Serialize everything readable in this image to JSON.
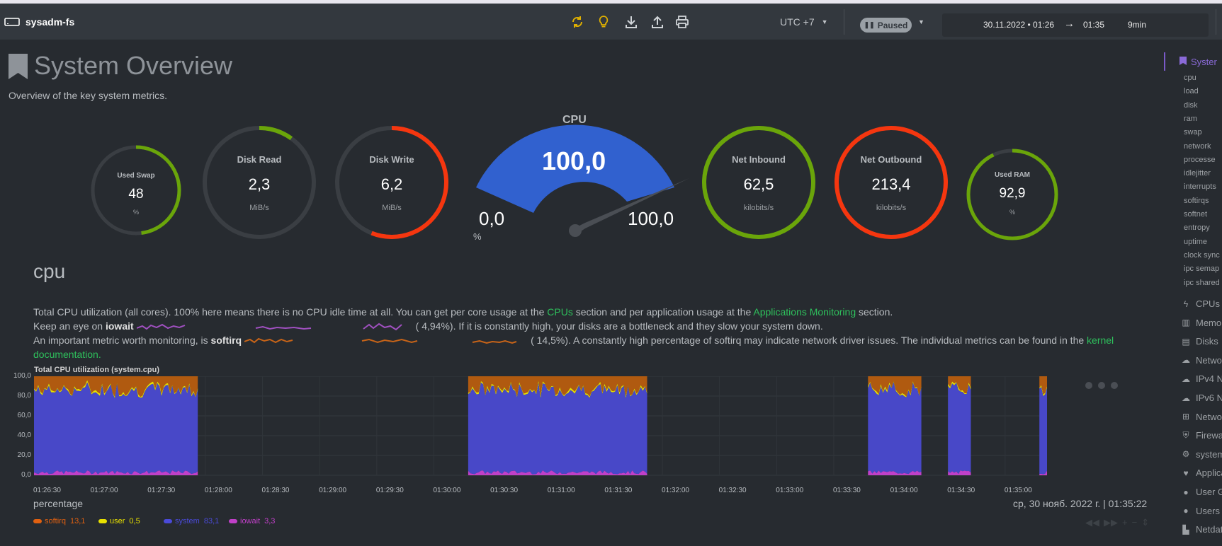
{
  "topbar": {
    "hostname": "sysadm-fs",
    "timezone": "UTC +7",
    "status": "Paused",
    "range_start": "30.11.2022 • 01:26",
    "range_end": "01:35",
    "duration": "9min"
  },
  "page": {
    "title": "System Overview",
    "subtitle": "Overview of the key system metrics."
  },
  "gauges": {
    "used_swap": {
      "title": "Used Swap",
      "value": "48",
      "unit": "%",
      "fill": 0.48,
      "color": "#6aa50a"
    },
    "disk_read": {
      "title": "Disk Read",
      "value": "2,3",
      "unit": "MiB/s",
      "fill": 0.1,
      "color": "#6aa50a"
    },
    "disk_write": {
      "title": "Disk Write",
      "value": "6,2",
      "unit": "MiB/s",
      "fill": 0.56,
      "color": "#f5360f"
    },
    "cpu": {
      "title": "CPU",
      "value": "100,0",
      "min": "0,0",
      "max": "100,0",
      "unit": "%",
      "fill": 1.0,
      "color": "#3161cf"
    },
    "net_inbound": {
      "title": "Net Inbound",
      "value": "62,5",
      "unit": "kilobits/s",
      "fill": 1.0,
      "color": "#6aa50a"
    },
    "net_outbound": {
      "title": "Net Outbound",
      "value": "213,4",
      "unit": "kilobits/s",
      "fill": 1.0,
      "color": "#f5360f"
    },
    "used_ram": {
      "title": "Used RAM",
      "value": "92,9",
      "unit": "%",
      "fill": 0.929,
      "color": "#6aa50a"
    }
  },
  "cpu_section": {
    "title": "cpu",
    "line1_a": "Total CPU utilization (all cores). 100% here means there is no CPU idle time at all. You can get per core usage at the ",
    "line1_link1": "CPUs",
    "line1_b": " section and per application usage at the ",
    "line1_link2": "Applications Monitoring",
    "line1_c": " section.",
    "line2_a": "Keep an eye on ",
    "line2_b": "iowait",
    "line2_c": "(      4,94%). If it is constantly high, your disks are a bottleneck and they slow your system down.",
    "line3_a": "An important metric worth monitoring, is ",
    "line3_b": "softirq",
    "line3_c": "(      14,5%). A constantly high percentage of softirq may indicate network driver issues. The individual metrics can be found in the ",
    "line3_link": "kernel",
    "line4_link": "documentation."
  },
  "chart": {
    "title": "Total CPU utilization (system.cpu)",
    "units": "percentage",
    "timestamp": "ср, 30 нояб. 2022 г. | 01:35:22",
    "y_ticks": [
      "100,0",
      "80,0",
      "60,0",
      "40,0",
      "20,0",
      "0,0"
    ],
    "x_ticks": [
      "01:26:30",
      "01:27:00",
      "01:27:30",
      "01:28:00",
      "01:28:30",
      "01:29:00",
      "01:29:30",
      "01:30:00",
      "01:30:30",
      "01:31:00",
      "01:31:30",
      "01:32:00",
      "01:32:30",
      "01:33:00",
      "01:33:30",
      "01:34:00",
      "01:34:30",
      "01:35:00"
    ],
    "legend": [
      {
        "name": "softirq",
        "value": "13,1",
        "color": "#e06010"
      },
      {
        "name": "user",
        "value": "0,5",
        "color": "#e8e000"
      },
      {
        "name": "system",
        "value": "83,1",
        "color": "#4a4ad8"
      },
      {
        "name": "iowait",
        "value": "3,3",
        "color": "#c040c8"
      }
    ]
  },
  "chart_data": {
    "type": "area",
    "title": "Total CPU utilization (system.cpu)",
    "ylabel": "percentage",
    "ylim": [
      0,
      100
    ],
    "x": [
      "01:26:30",
      "01:35:00"
    ],
    "series": [
      {
        "name": "softirq",
        "last_value": 13.1
      },
      {
        "name": "user",
        "last_value": 0.5
      },
      {
        "name": "system",
        "last_value": 83.1
      },
      {
        "name": "iowait",
        "last_value": 3.3
      }
    ],
    "active_intervals": [
      [
        "01:26:30",
        "01:27:56"
      ],
      [
        "01:30:18",
        "01:31:52"
      ],
      [
        "01:33:48",
        "01:34:16"
      ],
      [
        "01:34:30",
        "01:34:42"
      ],
      [
        "01:35:18",
        "01:35:22"
      ]
    ]
  },
  "nav": {
    "active": "Syster",
    "subitems": [
      "cpu",
      "load",
      "disk",
      "ram",
      "swap",
      "network",
      "processe",
      "idlejitter",
      "interrupts",
      "softirqs",
      "softnet",
      "entropy",
      "uptime",
      "clock sync",
      "ipc semap",
      "ipc shared"
    ],
    "sections": [
      {
        "label": "CPUs",
        "icon": "bolt-icon",
        "glyph": "ϟ"
      },
      {
        "label": "Memor",
        "icon": "memory-icon",
        "glyph": "▥"
      },
      {
        "label": "Disks",
        "icon": "disk-icon",
        "glyph": "▤"
      },
      {
        "label": "Networ",
        "icon": "cloud-icon",
        "glyph": "☁"
      },
      {
        "label": "IPv4 N",
        "icon": "cloud-icon",
        "glyph": "☁"
      },
      {
        "label": "IPv6 N",
        "icon": "cloud-icon",
        "glyph": "☁"
      },
      {
        "label": "Networ",
        "icon": "sitemap-icon",
        "glyph": "⊞"
      },
      {
        "label": "Firewa",
        "icon": "shield-icon",
        "glyph": "⛨"
      },
      {
        "label": "system",
        "icon": "gears-icon",
        "glyph": "⚙"
      },
      {
        "label": "Applica",
        "icon": "heartbeat-icon",
        "glyph": "♥"
      },
      {
        "label": "User G",
        "icon": "user-icon",
        "glyph": "●"
      },
      {
        "label": "Users",
        "icon": "users-icon",
        "glyph": "●"
      },
      {
        "label": "Netdat",
        "icon": "chart-icon",
        "glyph": "▙"
      }
    ]
  }
}
